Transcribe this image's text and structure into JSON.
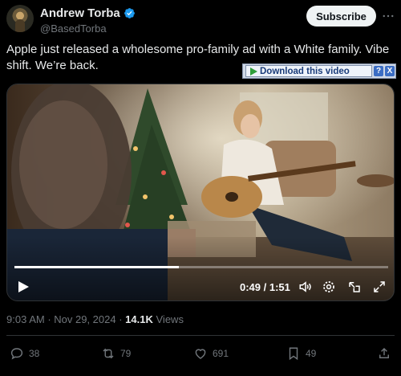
{
  "author": {
    "display_name": "Andrew Torba",
    "handle": "@BasedTorba",
    "verified_icon": "verified-badge-icon"
  },
  "header": {
    "subscribe_label": "Subscribe",
    "more_icon": "more-horizontal-icon"
  },
  "tweet": {
    "text": "Apple just released a wholesome pro-family ad with a White family. Vibe shift. We’re back."
  },
  "download_overlay": {
    "label": "Download this video",
    "help_icon": "?",
    "close_icon": "X"
  },
  "video": {
    "time_current": "0:49",
    "time_total": "1:51",
    "time_display": "0:49 / 1:51",
    "progress": 0.44,
    "controls": [
      "play-icon",
      "volume-icon",
      "settings-icon",
      "pip-icon",
      "fullscreen-icon"
    ]
  },
  "meta": {
    "time": "9:03 AM",
    "date": "Nov 29, 2024",
    "views_count": "14.1K",
    "views_label": "Views"
  },
  "actions": {
    "replies": "38",
    "reposts": "79",
    "likes": "691",
    "bookmarks": "49"
  },
  "colors": {
    "background": "#000000",
    "text": "#e7e9ea",
    "secondary": "#71767b",
    "verified": "#1d9bf0",
    "divider": "#2f3336"
  }
}
